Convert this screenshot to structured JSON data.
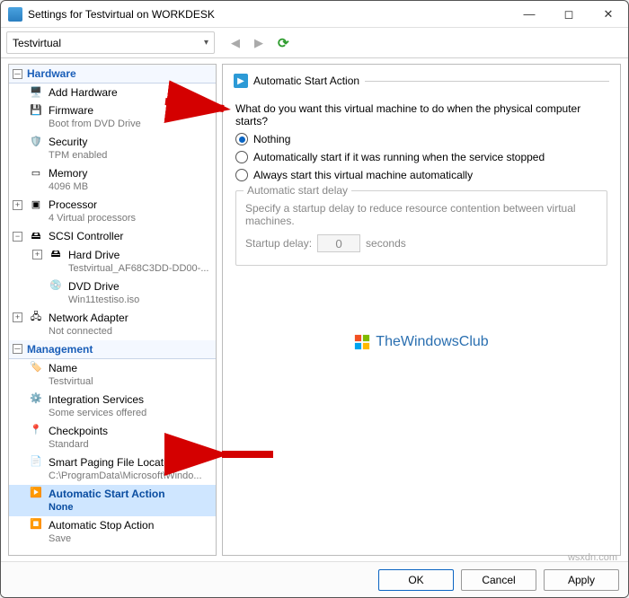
{
  "window": {
    "title": "Settings for Testvirtual on WORKDESK"
  },
  "vm_selector": {
    "value": "Testvirtual"
  },
  "sections": {
    "hardware": {
      "label": "Hardware",
      "items": {
        "add_hardware": {
          "label": "Add Hardware"
        },
        "firmware": {
          "label": "Firmware",
          "detail": "Boot from DVD Drive"
        },
        "security": {
          "label": "Security",
          "detail": "TPM enabled"
        },
        "memory": {
          "label": "Memory",
          "detail": "4096 MB"
        },
        "processor": {
          "label": "Processor",
          "detail": "4 Virtual processors"
        },
        "scsi": {
          "label": "SCSI Controller"
        },
        "hard_drive": {
          "label": "Hard Drive",
          "detail": "Testvirtual_AF68C3DD-DD00-..."
        },
        "dvd_drive": {
          "label": "DVD Drive",
          "detail": "Win11testiso.iso"
        },
        "network": {
          "label": "Network Adapter",
          "detail": "Not connected"
        }
      }
    },
    "management": {
      "label": "Management",
      "items": {
        "name": {
          "label": "Name",
          "detail": "Testvirtual"
        },
        "integration": {
          "label": "Integration Services",
          "detail": "Some services offered"
        },
        "checkpoints": {
          "label": "Checkpoints",
          "detail": "Standard"
        },
        "paging": {
          "label": "Smart Paging File Location",
          "detail": "C:\\ProgramData\\Microsoft\\Windo..."
        },
        "auto_start": {
          "label": "Automatic Start Action",
          "detail": "None"
        },
        "auto_stop": {
          "label": "Automatic Stop Action",
          "detail": "Save"
        }
      }
    }
  },
  "right": {
    "title": "Automatic Start Action",
    "question": "What do you want this virtual machine to do when the physical computer starts?",
    "options": {
      "nothing": "Nothing",
      "if_running": "Automatically start if it was running when the service stopped",
      "always": "Always start this virtual machine automatically"
    },
    "selected": "nothing",
    "delay_group": {
      "legend": "Automatic start delay",
      "desc": "Specify a startup delay to reduce resource contention between virtual machines.",
      "label": "Startup delay:",
      "value": "0",
      "unit": "seconds"
    },
    "watermark": "TheWindowsClub",
    "credit": "wsxdn.com"
  },
  "buttons": {
    "ok": "OK",
    "cancel": "Cancel",
    "apply": "Apply"
  }
}
